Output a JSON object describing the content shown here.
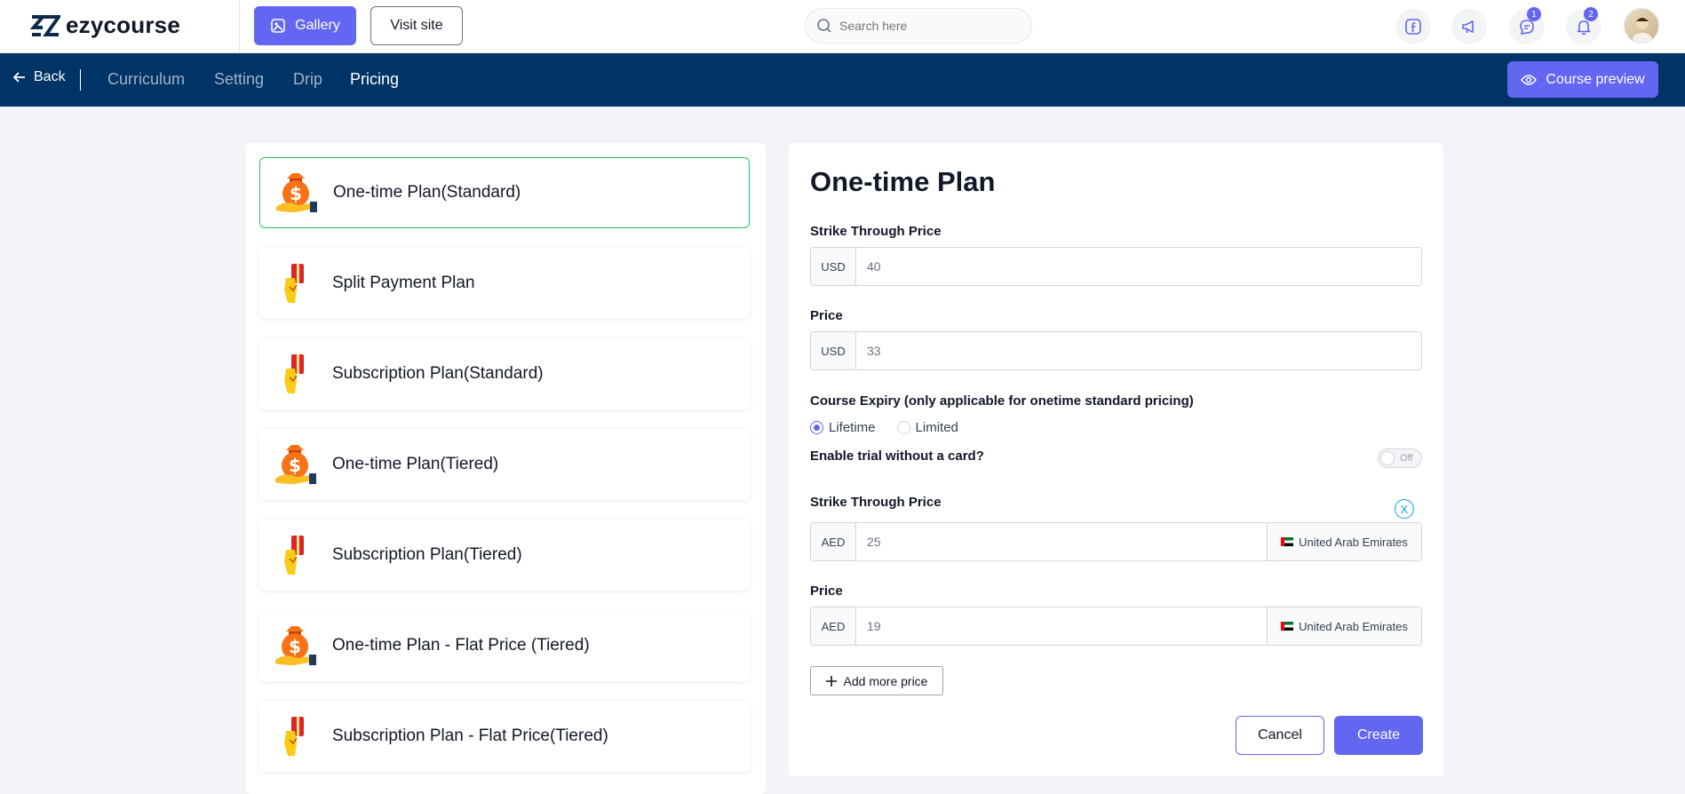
{
  "brand": {
    "name": "ezycourse",
    "accent": "#6366f1",
    "nav_bg": "#003366"
  },
  "header": {
    "gallery_label": "Gallery",
    "visit_label": "Visit site",
    "search_placeholder": "Search here",
    "icons": [
      {
        "name": "facebook-icon"
      },
      {
        "name": "megaphone-icon"
      },
      {
        "name": "chat-icon",
        "badge": "1"
      },
      {
        "name": "bell-icon",
        "badge": "2"
      }
    ]
  },
  "nav": {
    "back_label": "Back",
    "tabs": [
      {
        "label": "Curriculum",
        "active": false
      },
      {
        "label": "Setting",
        "active": false
      },
      {
        "label": "Drip",
        "active": false
      },
      {
        "label": "Pricing",
        "active": true
      }
    ],
    "preview_label": "Course preview"
  },
  "plans": [
    {
      "label": "One-time Plan(Standard)",
      "icon": "money-bag-icon",
      "selected": true
    },
    {
      "label": "Split Payment Plan",
      "icon": "card-hand-icon",
      "selected": false
    },
    {
      "label": "Subscription Plan(Standard)",
      "icon": "card-hand-icon",
      "selected": false
    },
    {
      "label": "One-time Plan(Tiered)",
      "icon": "money-bag-icon",
      "selected": false
    },
    {
      "label": "Subscription Plan(Tiered)",
      "icon": "card-hand-icon",
      "selected": false
    },
    {
      "label": "One-time Plan - Flat Price (Tiered)",
      "icon": "money-bag-icon",
      "selected": false
    },
    {
      "label": "Subscription Plan - Flat Price(Tiered)",
      "icon": "card-hand-icon",
      "selected": false
    }
  ],
  "form": {
    "title": "One-time Plan",
    "strike_label": "Strike Through Price",
    "strike_currency": "USD",
    "strike_value": "40",
    "price_label": "Price",
    "price_currency": "USD",
    "price_value": "33",
    "expiry_label": "Course Expiry (only applicable for onetime standard pricing)",
    "expiry_options": [
      "Lifetime",
      "Limited"
    ],
    "expiry_selected": "Lifetime",
    "trial_label": "Enable trial without a card?",
    "trial_toggle": "Off",
    "extra_strike_label": "Strike Through Price",
    "extra_strike_currency": "AED",
    "extra_strike_value": "25",
    "extra_strike_country": "United Arab Emirates",
    "extra_price_label": "Price",
    "extra_price_currency": "AED",
    "extra_price_value": "19",
    "extra_price_country": "United Arab Emirates",
    "remove_label": "X",
    "add_more_label": "Add more price",
    "cancel_label": "Cancel",
    "create_label": "Create"
  }
}
